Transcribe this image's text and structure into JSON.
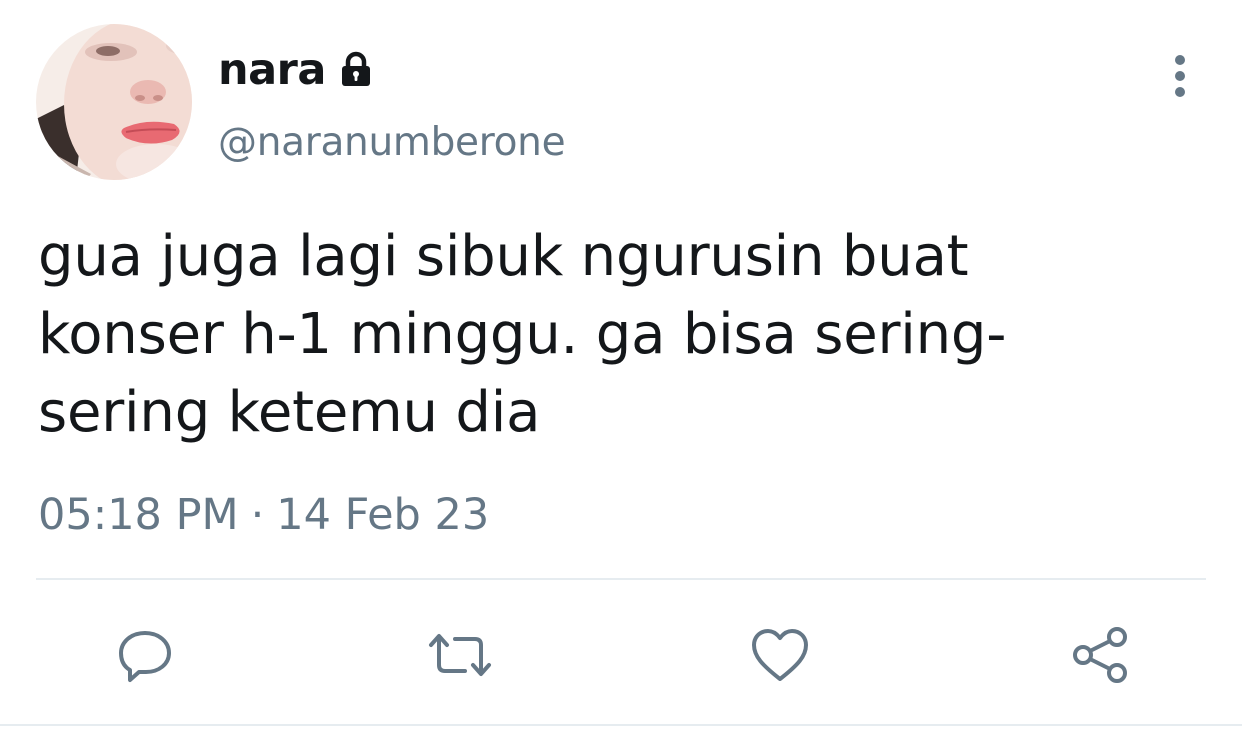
{
  "tweet": {
    "display_name": "nara",
    "handle": "@naranumberone",
    "text": "gua juga lagi sibuk ngurusin buat konser h-1 minggu. ga bisa sering-sering ketemu dia",
    "text_lines": [
      "gua juga lagi sibuk ngurusin buat",
      "konser h-1 minggu. ga bisa sering-",
      "sering ketemu dia"
    ],
    "time": "05:18 PM",
    "separator": "·",
    "date": "14 Feb 23",
    "protected": true
  },
  "icons": {
    "lock": "lock-icon",
    "more": "more-vertical-icon",
    "reply": "reply-icon",
    "retweet": "retweet-icon",
    "like": "heart-icon",
    "share": "share-icon"
  },
  "colors": {
    "primary_text": "#14171a",
    "secondary_text": "#657786",
    "divider": "#e6ecf0",
    "icon": "#657786"
  }
}
